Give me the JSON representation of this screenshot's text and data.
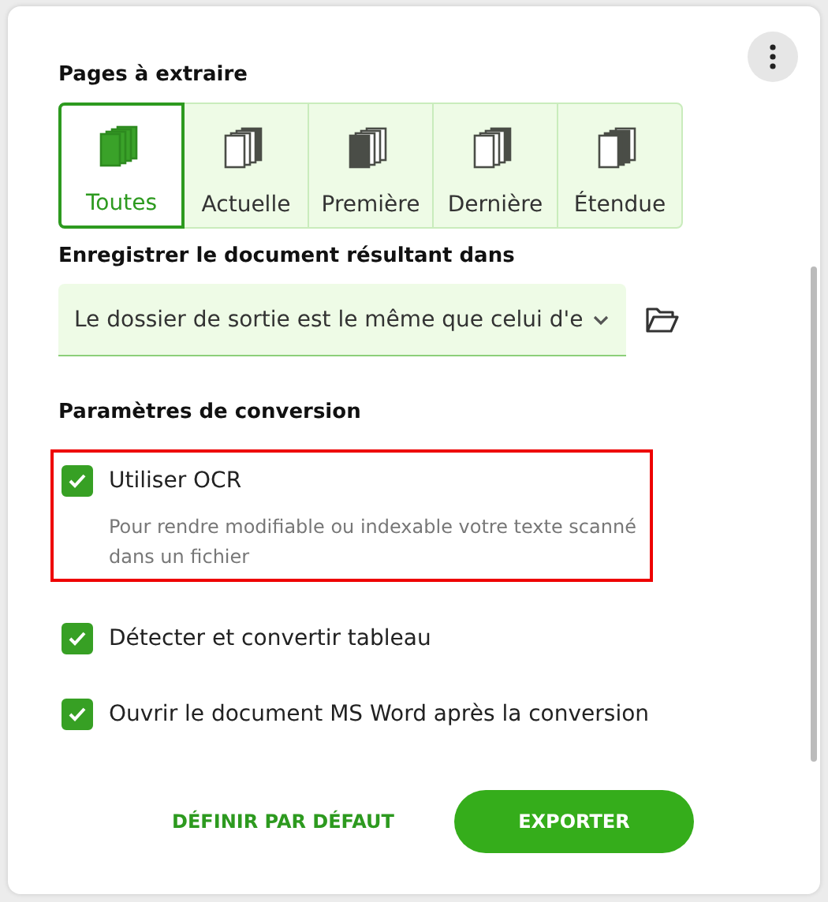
{
  "pages_section": {
    "title": "Pages à extraire",
    "options": [
      {
        "label": "Toutes",
        "kind": "all",
        "selected": true
      },
      {
        "label": "Actuelle",
        "kind": "current",
        "selected": false
      },
      {
        "label": "Première",
        "kind": "first",
        "selected": false
      },
      {
        "label": "Dernière",
        "kind": "last",
        "selected": false
      },
      {
        "label": "Étendue",
        "kind": "range",
        "selected": false
      }
    ]
  },
  "save_section": {
    "title": "Enregistrer le document résultant dans",
    "folder_value": "Le dossier de sortie est le même que celui d'e"
  },
  "conversion_section": {
    "title": "Paramètres de conversion",
    "options": [
      {
        "label": "Utiliser OCR",
        "description": "Pour rendre modifiable ou indexable votre texte scanné dans un fichier",
        "checked": true,
        "highlighted": true
      },
      {
        "label": "Détecter et convertir tableau",
        "checked": true,
        "highlighted": false
      },
      {
        "label": "Ouvrir le document MS Word après la conversion",
        "checked": true,
        "highlighted": false
      }
    ]
  },
  "buttons": {
    "secondary": "DÉFINIR PAR DÉFAUT",
    "primary": "EXPORTER"
  }
}
